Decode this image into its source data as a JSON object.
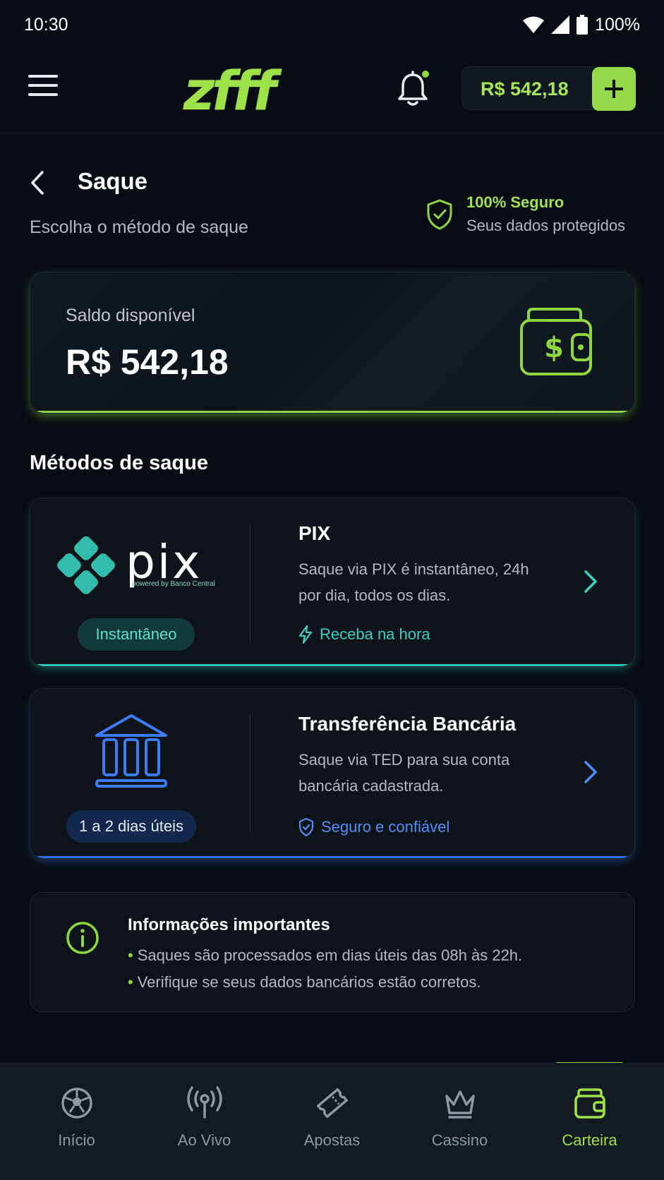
{
  "status_bar": {
    "time": "10:30",
    "battery": "100%"
  },
  "header": {
    "logo": "zfff",
    "balance": "R$ 542,18",
    "add_label": "+"
  },
  "page": {
    "title": "Saque",
    "subtitle": "Escolha o método de saque",
    "secure_title": "100% Seguro",
    "secure_subtitle": "Seus dados protegidos"
  },
  "balance_card": {
    "label": "Saldo disponível",
    "value": "R$ 542,18"
  },
  "methods_title": "Métodos de saque",
  "methods": [
    {
      "id": "pix",
      "logo_text": "pix",
      "logo_tagline": "powered by Banco Central",
      "badge": "Instantâneo",
      "title": "PIX",
      "description": "Saque via PIX é instantâneo, 24h por dia, todos os dias.",
      "feature": "Receba na hora",
      "accent": "#2cc6bb"
    },
    {
      "id": "bank",
      "badge": "1 a 2 dias úteis",
      "title": "Transferência Bancária",
      "description": "Saque via TED para sua conta bancária cadastrada.",
      "feature": "Seguro e confiável",
      "accent": "#2e6ff0"
    }
  ],
  "info": {
    "title": "Informações importantes",
    "items": [
      "Saques são processados em dias úteis das 08h às 22h.",
      "Verifique se seus dados bancários estão corretos."
    ]
  },
  "bottom_nav": [
    {
      "label": "Início",
      "icon": "soccer-ball-icon",
      "active": false
    },
    {
      "label": "Ao Vivo",
      "icon": "live-broadcast-icon",
      "active": false
    },
    {
      "label": "Apostas",
      "icon": "ticket-icon",
      "active": false
    },
    {
      "label": "Cassino",
      "icon": "crown-icon",
      "active": false
    },
    {
      "label": "Carteira",
      "icon": "wallet-icon",
      "active": true
    }
  ],
  "colors": {
    "accent_green": "#8fd741",
    "pix_teal": "#2cc6bb",
    "bank_blue": "#2e6ff0",
    "background": "#090d13"
  }
}
